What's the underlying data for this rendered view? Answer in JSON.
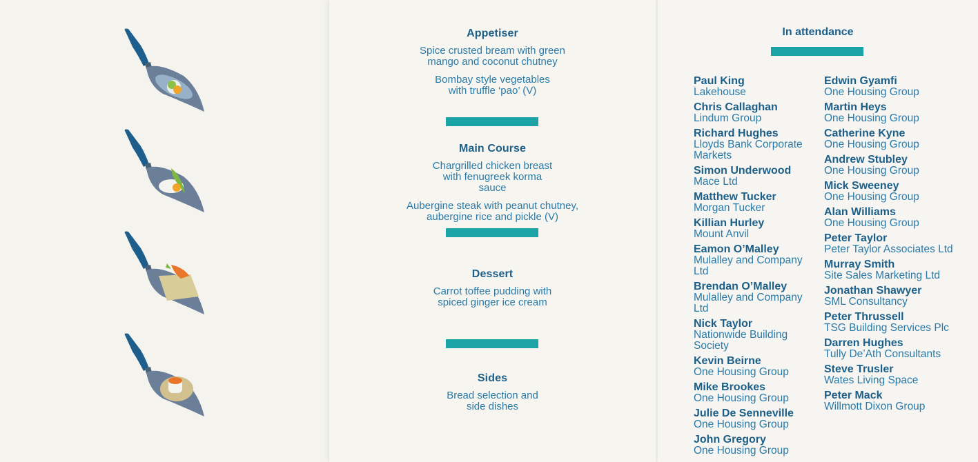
{
  "colors": {
    "accent": "#1ba3a6",
    "text_dark": "#1c5f88",
    "text_light": "#2a7aa7"
  },
  "illustrations": [
    "trowel-fish-icon",
    "trowel-rice-icon",
    "trowel-pudding-icon",
    "trowel-bread-icon"
  ],
  "menu": {
    "appetiser": {
      "heading": "Appetiser",
      "item1": "Spice crusted bream with green mango and coconut chutney",
      "item2": "Bombay style vegetables with truffle ‘pao’ (V)"
    },
    "main": {
      "heading": "Main Course",
      "item1": "Chargrilled chicken breast with fenugreek korma sauce",
      "item2": "Aubergine steak with peanut chutney, aubergine rice and pickle (V)"
    },
    "dessert": {
      "heading": "Dessert",
      "item1": "Carrot toffee pudding with spiced ginger ice cream"
    },
    "sides": {
      "heading": "Sides",
      "item1": "Bread selection and side dishes"
    }
  },
  "attendance": {
    "title": "In attendance",
    "left": [
      {
        "name": "Paul King",
        "company": "Lakehouse"
      },
      {
        "name": "Chris Callaghan",
        "company": "Lindum Group"
      },
      {
        "name": "Richard Hughes",
        "company": "Lloyds Bank Corporate Markets"
      },
      {
        "name": "Simon Underwood",
        "company": "Mace Ltd"
      },
      {
        "name": "Matthew Tucker",
        "company": "Morgan Tucker"
      },
      {
        "name": "Killian Hurley",
        "company": "Mount Anvil"
      },
      {
        "name": "Eamon O’Malley",
        "company": "Mulalley and Company Ltd"
      },
      {
        "name": "Brendan O’Malley",
        "company": "Mulalley and Company Ltd"
      },
      {
        "name": "Nick Taylor",
        "company": "Nationwide Building Society"
      },
      {
        "name": "Kevin Beirne",
        "company": "One Housing Group"
      },
      {
        "name": "Mike Brookes",
        "company": "One Housing Group"
      },
      {
        "name": "Julie De Senneville",
        "company": "One Housing Group"
      },
      {
        "name": "John Gregory",
        "company": "One Housing Group"
      }
    ],
    "right": [
      {
        "name": "Edwin Gyamfi",
        "company": "One Housing Group"
      },
      {
        "name": "Martin Heys",
        "company": "One Housing Group"
      },
      {
        "name": "Catherine Kyne",
        "company": "One Housing Group"
      },
      {
        "name": "Andrew Stubley",
        "company": "One Housing Group"
      },
      {
        "name": "Mick Sweeney",
        "company": "One Housing Group"
      },
      {
        "name": "Alan Williams",
        "company": "One Housing Group"
      },
      {
        "name": "Peter Taylor",
        "company": "Peter Taylor Associates Ltd"
      },
      {
        "name": "Murray Smith",
        "company": "Site Sales Marketing Ltd"
      },
      {
        "name": "Jonathan Shawyer",
        "company": "SML Consultancy"
      },
      {
        "name": "Peter Thrussell",
        "company": "TSG Building Services Plc"
      },
      {
        "name": "Darren Hughes",
        "company": "Tully De’Ath Consultants"
      },
      {
        "name": "Steve Trusler",
        "company": "Wates Living Space"
      },
      {
        "name": "Peter Mack",
        "company": "Willmott Dixon Group"
      }
    ]
  }
}
